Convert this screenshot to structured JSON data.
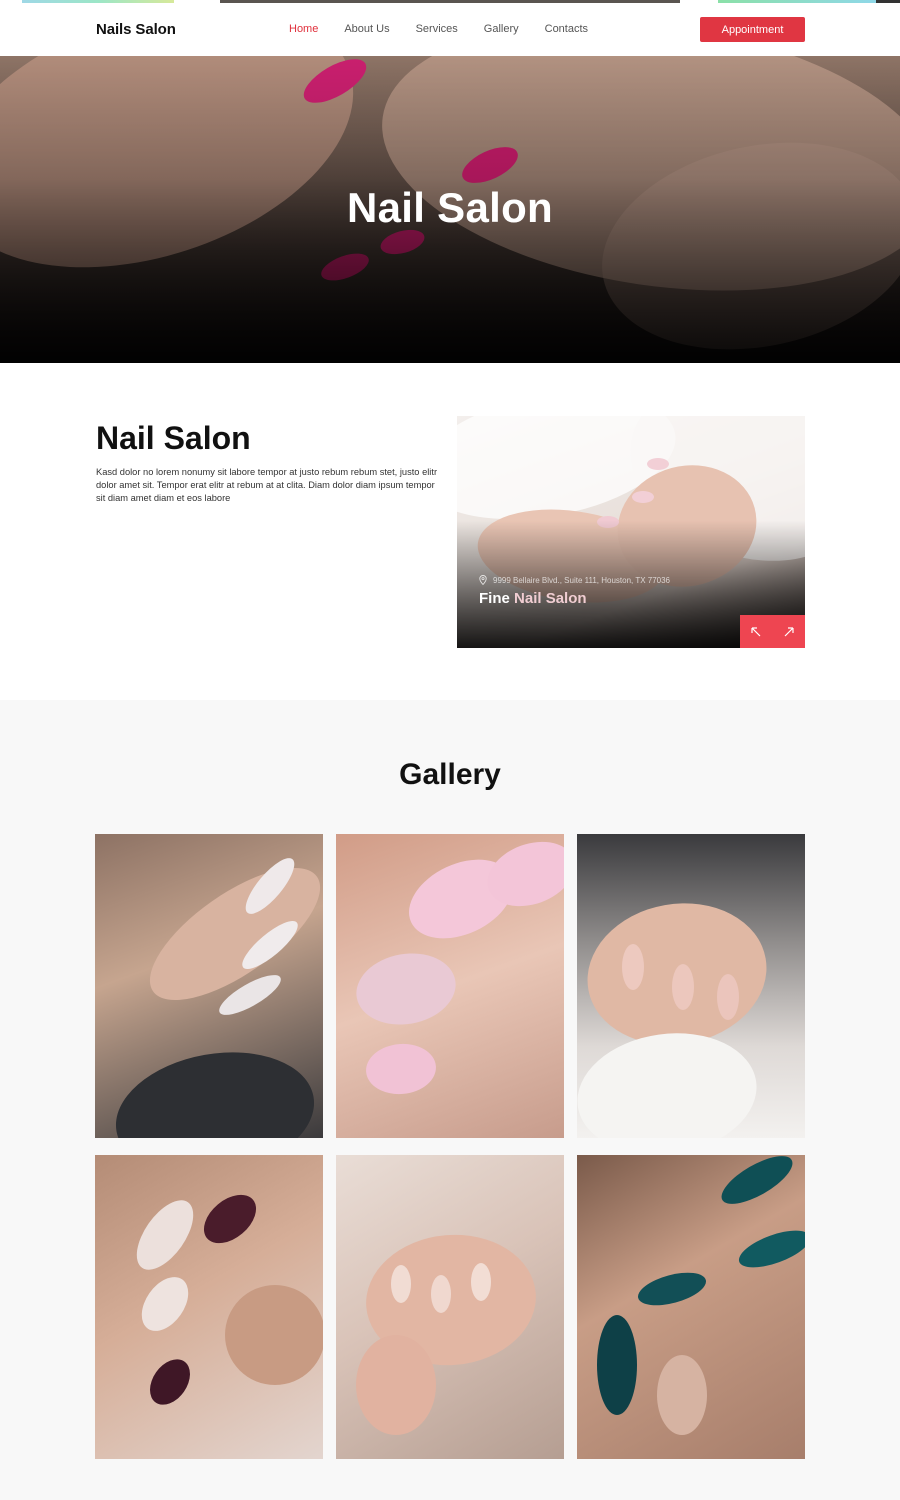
{
  "header": {
    "logo": "Nails Salon",
    "nav": [
      "Home",
      "About Us",
      "Services",
      "Gallery",
      "Contacts"
    ],
    "active_nav": "Home",
    "cta": "Appointment"
  },
  "hero": {
    "title": "Nail Salon"
  },
  "about": {
    "title": "Nail Salon",
    "text": "Kasd dolor no lorem nonumy sit labore tempor at justo rebum rebum stet, justo elitr dolor amet sit. Tempor erat elitr at rebum at at clita. Diam dolor diam ipsum tempor sit diam amet diam et eos labore"
  },
  "card": {
    "address": "9999 Bellaire Blvd., Suite 111, Houston, TX 77036",
    "name_first": "Fine",
    "name_accent": "Nail Salon",
    "prev_icon": "arrow-up-left-icon",
    "next_icon": "arrow-up-right-icon"
  },
  "gallery": {
    "title": "Gallery"
  },
  "colors": {
    "accent": "#e03642",
    "card_accent": "#ee4551"
  }
}
